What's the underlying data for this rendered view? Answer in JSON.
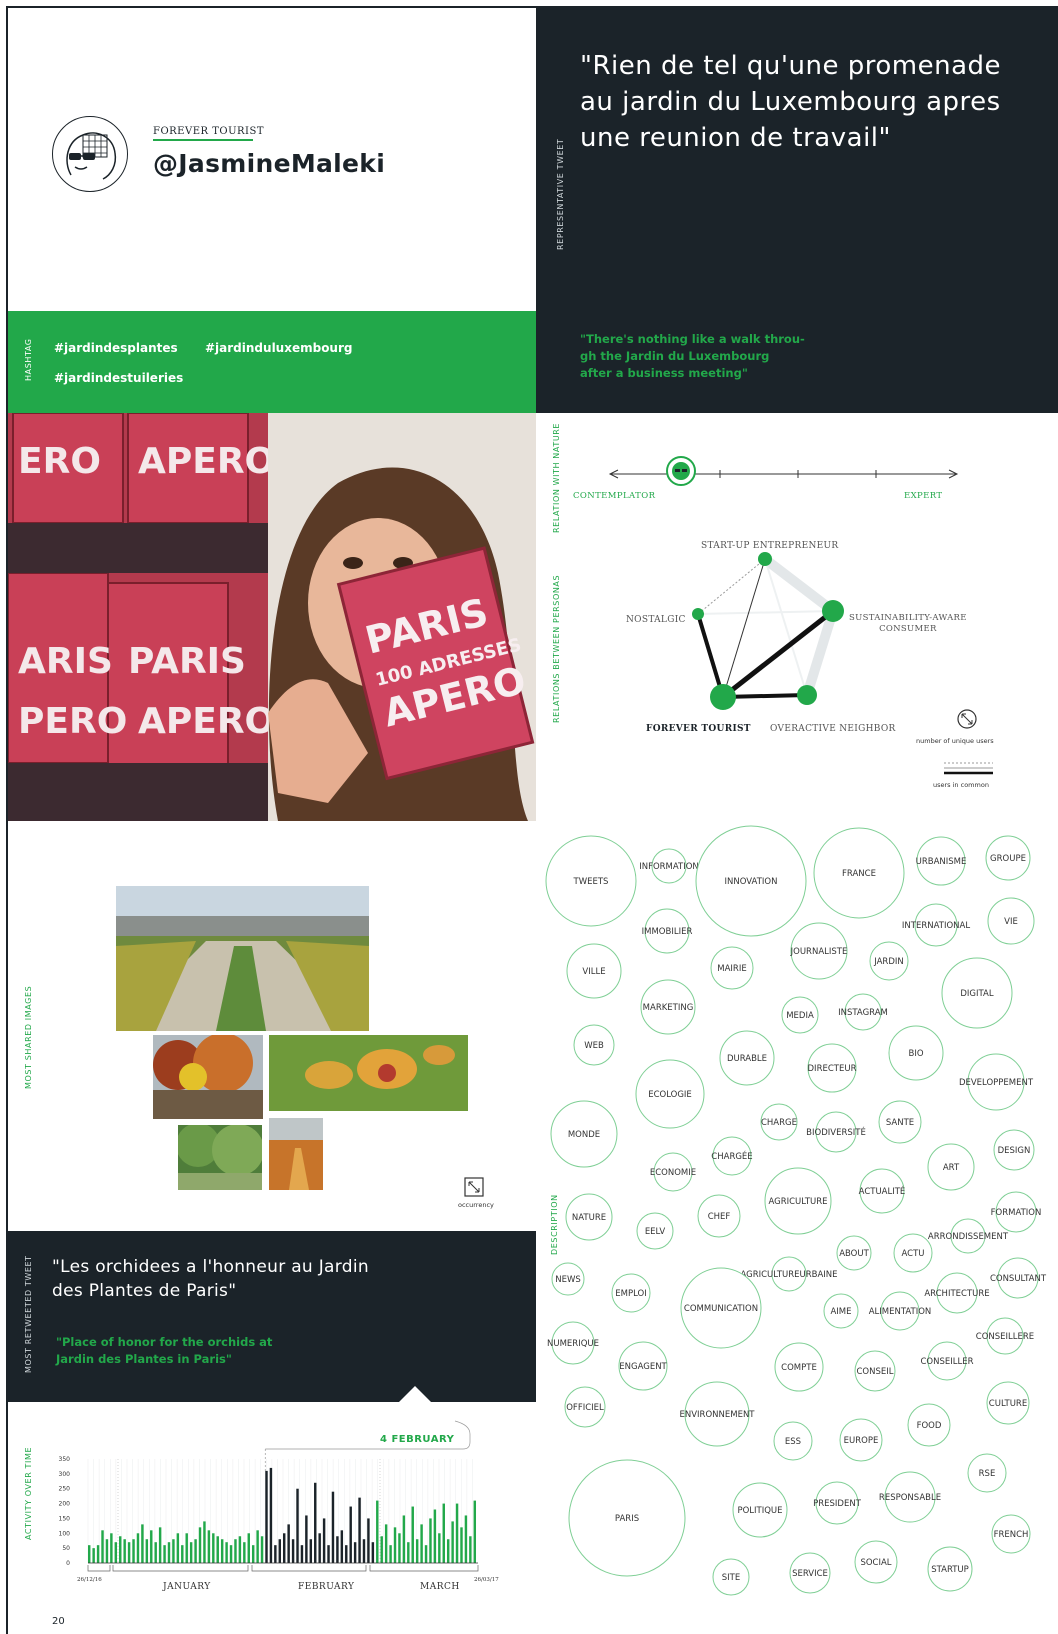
{
  "profile": {
    "persona": "FOREVER TOURIST",
    "handle": "@JasmineMaleki"
  },
  "representative_tweet": {
    "label": "REPRESENTATIVE TWEET",
    "quote": "\"Rien de tel qu'une promenade au jardin du Luxembourg apres une reunion de travail\"",
    "translation_lines": [
      "\"There's nothing like a walk throu-",
      "gh the Jardin du Luxembourg",
      "after a business meeting\""
    ]
  },
  "hashtags": {
    "label": "HASHTAG",
    "items": [
      "#jardindesplantes",
      "#jardinduluxembourg",
      "#jardindestuileries"
    ]
  },
  "nature_relation": {
    "label": "RELATION WITH NATURE",
    "left": "CONTEMPLATOR",
    "right": "EXPERT"
  },
  "personas": {
    "label": "RELATIONS BETWEEN PERSONAS",
    "nodes": [
      "START-UP ENTREPRENEUR",
      "SUSTAINABILITY-AWARE",
      "CONSUMER",
      "NOSTALGIC",
      "FOREVER TOURIST",
      "OVERACTIVE NEIGHBOR"
    ],
    "legend_unique": "number of unique users",
    "legend_common": "users in common"
  },
  "images": {
    "label": "MOST SHARED IMAGES",
    "legend": "occurrency"
  },
  "retweeted": {
    "label": "MOST RETWEETED TWEET",
    "quote_lines": [
      "\"Les orchidees a l'honneur au Jardin",
      "des Plantes de Paris\""
    ],
    "translation_lines": [
      "\"Place of honor for the orchids at",
      "Jardin des Plantes in Paris\""
    ]
  },
  "activity": {
    "label": "ACTIVITY OVER TIME",
    "highlight": "4 FEBRUARY",
    "start_date": "26/12/16",
    "end_date": "26/03/17",
    "months": [
      "JANUARY",
      "FEBRUARY",
      "MARCH"
    ]
  },
  "description": {
    "label": "DESCRIPTION"
  },
  "page_number": "20",
  "colors": {
    "green": "#22a84a",
    "dark": "#1b2329",
    "bubble_stroke": "#7fcf95"
  },
  "chart_data": {
    "type": "bar",
    "title": "",
    "xlabel": "",
    "ylabel": "",
    "ylim": [
      0,
      350
    ],
    "yticks": [
      0,
      50,
      100,
      150,
      200,
      250,
      300,
      350
    ],
    "highlight_bar_index": 40,
    "highlight_range": [
      40,
      64
    ],
    "values": [
      60,
      50,
      60,
      110,
      80,
      100,
      70,
      90,
      80,
      70,
      80,
      100,
      130,
      80,
      110,
      70,
      120,
      60,
      70,
      80,
      100,
      60,
      100,
      70,
      80,
      120,
      140,
      110,
      100,
      90,
      80,
      70,
      60,
      80,
      90,
      70,
      100,
      60,
      110,
      90,
      310,
      320,
      60,
      80,
      100,
      130,
      80,
      250,
      60,
      160,
      80,
      270,
      100,
      150,
      60,
      240,
      90,
      110,
      60,
      190,
      70,
      220,
      80,
      150,
      70,
      210,
      90,
      130,
      60,
      120,
      100,
      160,
      70,
      190,
      80,
      130,
      60,
      150,
      180,
      100,
      200,
      80,
      140,
      200,
      120,
      160,
      90,
      210
    ]
  },
  "bubbles": [
    {
      "label": "TWEETS",
      "value": 45
    },
    {
      "label": "INFORMATION",
      "value": 17
    },
    {
      "label": "INNOVATION",
      "value": 55
    },
    {
      "label": "FRANCE",
      "value": 45
    },
    {
      "label": "URBANISME",
      "value": 24
    },
    {
      "label": "GROUPE",
      "value": 22
    },
    {
      "label": "IMMOBILIER",
      "value": 22
    },
    {
      "label": "INTERNATIONAL",
      "value": 21
    },
    {
      "label": "VIE",
      "value": 23
    },
    {
      "label": "JOURNALISTE",
      "value": 28
    },
    {
      "label": "JARDIN",
      "value": 19
    },
    {
      "label": "VILLE",
      "value": 27
    },
    {
      "label": "MAIRIE",
      "value": 21
    },
    {
      "label": "DIGITAL",
      "value": 35
    },
    {
      "label": "MARKETING",
      "value": 27
    },
    {
      "label": "MEDIA",
      "value": 18
    },
    {
      "label": "INSTAGRAM",
      "value": 18
    },
    {
      "label": "WEB",
      "value": 20
    },
    {
      "label": "BIO",
      "value": 27
    },
    {
      "label": "DURABLE",
      "value": 27
    },
    {
      "label": "DIRECTEUR",
      "value": 24
    },
    {
      "label": "DEVELOPPEMENT",
      "value": 28
    },
    {
      "label": "ECOLOGIE",
      "value": 34
    },
    {
      "label": "CHARGE",
      "value": 18
    },
    {
      "label": "MONDE",
      "value": 33
    },
    {
      "label": "BIODIVERSITÉ",
      "value": 20
    },
    {
      "label": "SANTE",
      "value": 21
    },
    {
      "label": "DESIGN",
      "value": 20
    },
    {
      "label": "CHARGÉE",
      "value": 19
    },
    {
      "label": "ART",
      "value": 23
    },
    {
      "label": "ECONOMIE",
      "value": 19
    },
    {
      "label": "ACTUALITÉ",
      "value": 22
    },
    {
      "label": "AGRICULTURE",
      "value": 33
    },
    {
      "label": "NATURE",
      "value": 23
    },
    {
      "label": "FORMATION",
      "value": 20
    },
    {
      "label": "EELV",
      "value": 18
    },
    {
      "label": "CHEF",
      "value": 21
    },
    {
      "label": "ARRONDISSEMENT",
      "value": 17
    },
    {
      "label": "ABOUT",
      "value": 17
    },
    {
      "label": "ACTU",
      "value": 19
    },
    {
      "label": "NEWS",
      "value": 16
    },
    {
      "label": "EMPLOI",
      "value": 19
    },
    {
      "label": "AGRICULTUREURBAINE",
      "value": 17
    },
    {
      "label": "CONSULTANT",
      "value": 20
    },
    {
      "label": "ARCHITECTURE",
      "value": 20
    },
    {
      "label": "COMMUNICATION",
      "value": 40
    },
    {
      "label": "AIME",
      "value": 17
    },
    {
      "label": "ALIMENTATION",
      "value": 19
    },
    {
      "label": "NUMERIQUE",
      "value": 21
    },
    {
      "label": "CONSEILLERE",
      "value": 18
    },
    {
      "label": "ENGAGENT",
      "value": 24
    },
    {
      "label": "COMPTE",
      "value": 24
    },
    {
      "label": "CONSEIL",
      "value": 20
    },
    {
      "label": "CONSEILLER",
      "value": 19
    },
    {
      "label": "OFFICIEL",
      "value": 20
    },
    {
      "label": "ENVIRONNEMENT",
      "value": 32
    },
    {
      "label": "CULTURE",
      "value": 21
    },
    {
      "label": "FOOD",
      "value": 21
    },
    {
      "label": "ESS",
      "value": 19
    },
    {
      "label": "EUROPE",
      "value": 21
    },
    {
      "label": "RSE",
      "value": 19
    },
    {
      "label": "PARIS",
      "value": 58
    },
    {
      "label": "POLITIQUE",
      "value": 27
    },
    {
      "label": "PRESIDENT",
      "value": 21
    },
    {
      "label": "RESPONSABLE",
      "value": 25
    },
    {
      "label": "FRENCH",
      "value": 19
    },
    {
      "label": "SITE",
      "value": 18
    },
    {
      "label": "SERVICE",
      "value": 20
    },
    {
      "label": "SOCIAL",
      "value": 21
    },
    {
      "label": "STARTUP",
      "value": 22
    }
  ]
}
